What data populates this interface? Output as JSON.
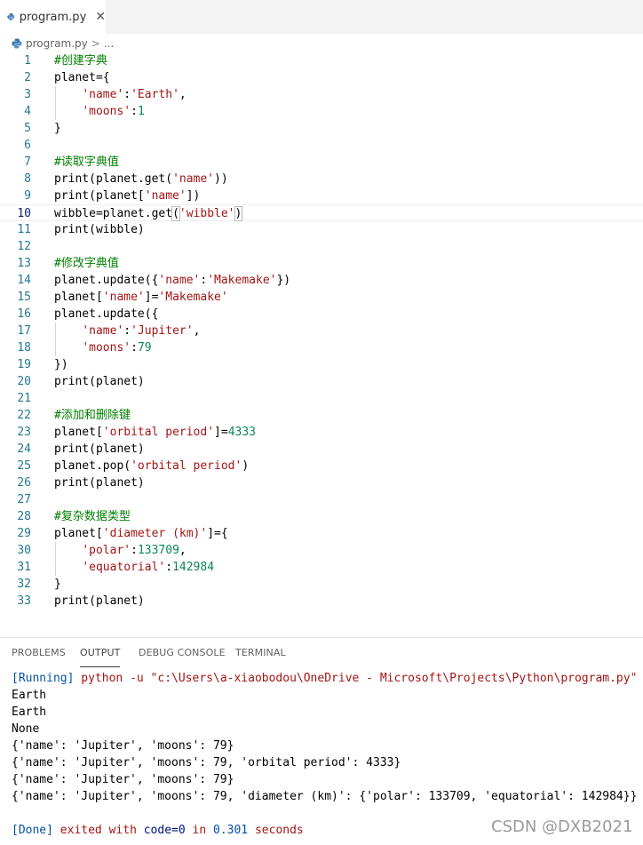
{
  "tab": {
    "label": "program.py",
    "close": "✕"
  },
  "breadcrumb": {
    "file": "program.py",
    "sep": ">",
    "more": "..."
  },
  "editor": {
    "active_line": 10,
    "lines": [
      {
        "n": "1",
        "segs": [
          [
            "cmt",
            "#创建字典"
          ]
        ]
      },
      {
        "n": "2",
        "segs": [
          [
            "plain",
            "planet={"
          ]
        ]
      },
      {
        "n": "3",
        "segs": [
          [
            "plain",
            "    "
          ],
          [
            "str",
            "'name'"
          ],
          [
            "plain",
            ":"
          ],
          [
            "str",
            "'Earth'"
          ],
          [
            "plain",
            ","
          ]
        ]
      },
      {
        "n": "4",
        "segs": [
          [
            "plain",
            "    "
          ],
          [
            "str",
            "'moons'"
          ],
          [
            "plain",
            ":"
          ],
          [
            "num",
            "1"
          ]
        ]
      },
      {
        "n": "5",
        "segs": [
          [
            "plain",
            "}"
          ]
        ]
      },
      {
        "n": "6",
        "segs": []
      },
      {
        "n": "7",
        "segs": [
          [
            "cmt",
            "#读取字典值"
          ]
        ]
      },
      {
        "n": "8",
        "segs": [
          [
            "plain",
            "print(planet.get("
          ],
          [
            "str",
            "'name'"
          ],
          [
            "plain",
            "))"
          ]
        ]
      },
      {
        "n": "9",
        "segs": [
          [
            "plain",
            "print(planet["
          ],
          [
            "str",
            "'name'"
          ],
          [
            "plain",
            "])"
          ]
        ]
      },
      {
        "n": "10",
        "segs": [
          [
            "plain",
            "wibble=planet.get"
          ],
          [
            "hl",
            "("
          ],
          [
            "str",
            "'wibble'"
          ],
          [
            "hl",
            ")"
          ]
        ]
      },
      {
        "n": "11",
        "segs": [
          [
            "plain",
            "print(wibble)"
          ]
        ]
      },
      {
        "n": "12",
        "segs": []
      },
      {
        "n": "13",
        "segs": [
          [
            "cmt",
            "#修改字典值"
          ]
        ]
      },
      {
        "n": "14",
        "segs": [
          [
            "plain",
            "planet.update({"
          ],
          [
            "str",
            "'name'"
          ],
          [
            "plain",
            ":"
          ],
          [
            "str",
            "'Makemake'"
          ],
          [
            "plain",
            "})"
          ]
        ]
      },
      {
        "n": "15",
        "segs": [
          [
            "plain",
            "planet["
          ],
          [
            "str",
            "'name'"
          ],
          [
            "plain",
            "]="
          ],
          [
            "str",
            "'Makemake'"
          ]
        ]
      },
      {
        "n": "16",
        "segs": [
          [
            "plain",
            "planet.update({"
          ]
        ]
      },
      {
        "n": "17",
        "segs": [
          [
            "plain",
            "    "
          ],
          [
            "str",
            "'name'"
          ],
          [
            "plain",
            ":"
          ],
          [
            "str",
            "'Jupiter'"
          ],
          [
            "plain",
            ","
          ]
        ]
      },
      {
        "n": "18",
        "segs": [
          [
            "plain",
            "    "
          ],
          [
            "str",
            "'moons'"
          ],
          [
            "plain",
            ":"
          ],
          [
            "num",
            "79"
          ]
        ]
      },
      {
        "n": "19",
        "segs": [
          [
            "plain",
            "})"
          ]
        ]
      },
      {
        "n": "20",
        "segs": [
          [
            "plain",
            "print(planet)"
          ]
        ]
      },
      {
        "n": "21",
        "segs": []
      },
      {
        "n": "22",
        "segs": [
          [
            "cmt",
            "#添加和删除键"
          ]
        ]
      },
      {
        "n": "23",
        "segs": [
          [
            "plain",
            "planet["
          ],
          [
            "str",
            "'orbital period'"
          ],
          [
            "plain",
            "]="
          ],
          [
            "num",
            "4333"
          ]
        ]
      },
      {
        "n": "24",
        "segs": [
          [
            "plain",
            "print(planet)"
          ]
        ]
      },
      {
        "n": "25",
        "segs": [
          [
            "plain",
            "planet.pop("
          ],
          [
            "str",
            "'orbital period'"
          ],
          [
            "plain",
            ")"
          ]
        ]
      },
      {
        "n": "26",
        "segs": [
          [
            "plain",
            "print(planet)"
          ]
        ]
      },
      {
        "n": "27",
        "segs": []
      },
      {
        "n": "28",
        "segs": [
          [
            "cmt",
            "#复杂数据类型"
          ]
        ]
      },
      {
        "n": "29",
        "segs": [
          [
            "plain",
            "planet["
          ],
          [
            "str",
            "'diameter (km)'"
          ],
          [
            "plain",
            "]={"
          ]
        ]
      },
      {
        "n": "30",
        "segs": [
          [
            "plain",
            "    "
          ],
          [
            "str",
            "'polar'"
          ],
          [
            "plain",
            ":"
          ],
          [
            "num",
            "133709"
          ],
          [
            "plain",
            ","
          ]
        ]
      },
      {
        "n": "31",
        "segs": [
          [
            "plain",
            "    "
          ],
          [
            "str",
            "'equatorial'"
          ],
          [
            "plain",
            ":"
          ],
          [
            "num",
            "142984"
          ]
        ]
      },
      {
        "n": "32",
        "segs": [
          [
            "plain",
            "}"
          ]
        ]
      },
      {
        "n": "33",
        "segs": [
          [
            "plain",
            "print(planet)"
          ]
        ]
      }
    ]
  },
  "panel": {
    "tabs": [
      "PROBLEMS",
      "OUTPUT",
      "DEBUG CONSOLE",
      "TERMINAL"
    ],
    "active_tab": "OUTPUT",
    "output": [
      [
        [
          "blue",
          "[Running] "
        ],
        [
          "red",
          "python -u \"c:\\Users\\a-xiaobodou\\OneDrive - Microsoft\\Projects\\Python\\program.py\""
        ]
      ],
      [
        [
          "plain",
          "Earth"
        ]
      ],
      [
        [
          "plain",
          "Earth"
        ]
      ],
      [
        [
          "plain",
          "None"
        ]
      ],
      [
        [
          "plain",
          "{'name': 'Jupiter', 'moons': 79}"
        ]
      ],
      [
        [
          "plain",
          "{'name': 'Jupiter', 'moons': 79, 'orbital period': 4333}"
        ]
      ],
      [
        [
          "plain",
          "{'name': 'Jupiter', 'moons': 79}"
        ]
      ],
      [
        [
          "plain",
          "{'name': 'Jupiter', 'moons': 79, 'diameter (km)': {'polar': 133709, 'equatorial': 142984}}"
        ]
      ],
      [],
      [
        [
          "blue",
          "[Done] "
        ],
        [
          "red",
          "exited with "
        ],
        [
          "dblue",
          "code=0"
        ],
        [
          "red",
          " in "
        ],
        [
          "blue",
          "0.301"
        ],
        [
          "red",
          " seconds"
        ]
      ]
    ]
  },
  "watermark": "CSDN @DXB2021",
  "colors": {
    "comment": "#008000",
    "string": "#a31515",
    "number": "#098658",
    "line_number": "#237893"
  },
  "icons": {
    "file": "python-file-icon"
  }
}
